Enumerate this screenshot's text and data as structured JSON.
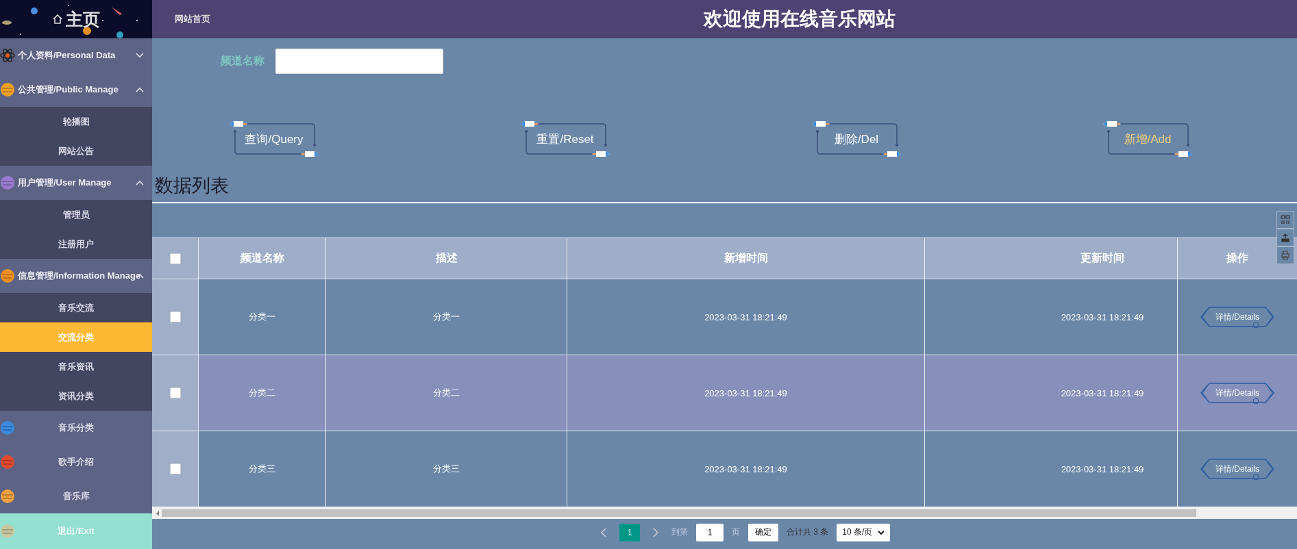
{
  "sidebar": {
    "logo": "主页",
    "menus": [
      {
        "kind": "group",
        "label": "个人资料/Personal Data",
        "expanded": false
      },
      {
        "kind": "group",
        "label": "公共管理/Public Manage",
        "expanded": true,
        "children": [
          {
            "label": "轮播图",
            "selected": false
          },
          {
            "label": "网站公告",
            "selected": false
          }
        ]
      },
      {
        "kind": "group",
        "label": "用户管理/User Manage",
        "expanded": true,
        "children": [
          {
            "label": "管理员",
            "selected": false
          },
          {
            "label": "注册用户",
            "selected": false
          }
        ]
      },
      {
        "kind": "group",
        "label": "信息管理/Information Manage",
        "expanded": true,
        "children": [
          {
            "label": "音乐交流",
            "selected": false
          },
          {
            "label": "交流分类",
            "selected": true
          },
          {
            "label": "音乐资讯",
            "selected": false
          },
          {
            "label": "资讯分类",
            "selected": false
          }
        ]
      },
      {
        "kind": "link",
        "label": "音乐分类"
      },
      {
        "kind": "link",
        "label": "歌手介绍"
      },
      {
        "kind": "link",
        "label": "音乐库"
      },
      {
        "kind": "exit",
        "label": "退出/Exit"
      }
    ]
  },
  "header": {
    "home_link": "网站首页",
    "title": "欢迎使用在线音乐网站"
  },
  "search": {
    "label": "频道名称"
  },
  "buttons": [
    {
      "label": "查询/Query",
      "hovered": false
    },
    {
      "label": "重置/Reset",
      "hovered": false
    },
    {
      "label": "删除/Del",
      "hovered": false
    },
    {
      "label": "新增/Add",
      "hovered": true
    }
  ],
  "section_title": "数据列表",
  "table": {
    "select_all": {
      "checked": false
    },
    "columns": [
      "频道名称",
      "描述",
      "新增时间",
      "更新时间",
      "操作"
    ],
    "rows": [
      {
        "checked": false,
        "highlighted": false,
        "cells": [
          "分类一",
          "分类一",
          "2023-03-31 18:21:49",
          "2023-03-31 18:21:49"
        ],
        "action": "详情/Details"
      },
      {
        "checked": false,
        "highlighted": true,
        "cells": [
          "分类二",
          "分类二",
          "2023-03-31 18:21:49",
          "2023-03-31 18:21:49"
        ],
        "action": "详情/Details"
      },
      {
        "checked": false,
        "highlighted": false,
        "cells": [
          "分类三",
          "分类三",
          "2023-03-31 18:21:49",
          "2023-03-31 18:21:49"
        ],
        "action": "详情/Details"
      }
    ]
  },
  "pagination": {
    "pages": [
      {
        "label": "1",
        "selected": true
      }
    ],
    "goto_label": "到第",
    "goto_value": "1",
    "page_unit": "页",
    "confirm": "确定",
    "total": "合计共 3 条",
    "page_size": "10 条/页"
  }
}
